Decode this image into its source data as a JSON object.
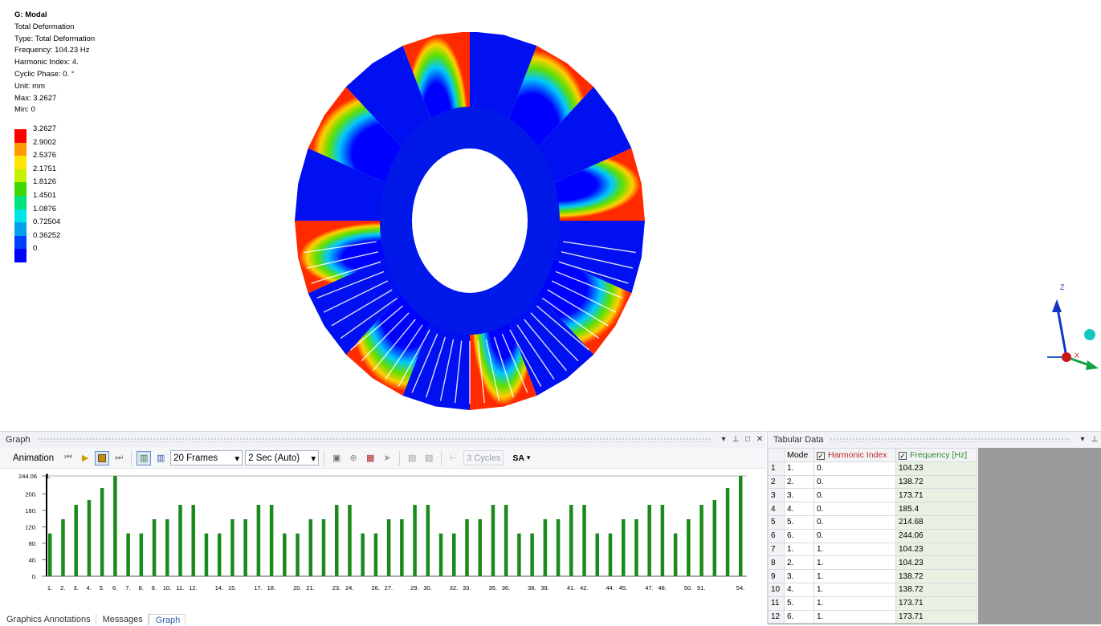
{
  "viewport": {
    "info": {
      "title": "G: Modal",
      "lines": [
        "Total Deformation",
        "Type: Total Deformation",
        "Frequency: 104.23 Hz",
        "Harmonic Index: 4.",
        "Cyclic Phase: 0. °",
        "Unit: mm",
        "Max: 3.2627",
        "Min: 0"
      ]
    },
    "legend": [
      {
        "label": "3.2627",
        "color": "#ff0000"
      },
      {
        "label": "2.9002",
        "color": "#ff9a00"
      },
      {
        "label": "2.5376",
        "color": "#ffe600"
      },
      {
        "label": "2.1751",
        "color": "#c5f000"
      },
      {
        "label": "1.8126",
        "color": "#3ed700"
      },
      {
        "label": "1.4501",
        "color": "#00e27c"
      },
      {
        "label": "1.0876",
        "color": "#00e5e5"
      },
      {
        "label": "0.72504",
        "color": "#00a2f0"
      },
      {
        "label": "0.36252",
        "color": "#0040ff"
      },
      {
        "label": "0",
        "color": "#0000ff"
      }
    ],
    "triad": {
      "z_label": "Z",
      "x_label": "X"
    }
  },
  "graph_panel": {
    "title": "Graph",
    "animation_label": "Animation",
    "frames_value": "20 Frames",
    "duration_value": "2 Sec (Auto)",
    "cycles_value": "3 Cycles",
    "sa_label": "SA",
    "bottom_tabs": [
      "Graphics Annotations",
      "Messages",
      "Graph"
    ]
  },
  "chart_data": {
    "type": "bar",
    "marker_label": "1.",
    "yticks": [
      "244.06",
      "200.",
      "160.",
      "120.",
      "80.",
      "40.",
      "0."
    ],
    "ytick_values": [
      244.06,
      200,
      160,
      120,
      80,
      40,
      0
    ],
    "ylim": [
      0,
      244.06
    ],
    "xtick_labels": [
      "1.",
      "2.",
      "3.",
      "4.",
      "5.",
      "6.",
      "7.",
      "8.",
      "9.",
      "10.",
      "11.",
      "12.",
      "14.",
      "15.",
      "17.",
      "18.",
      "20.",
      "21.",
      "23.",
      "24.",
      "26.",
      "27.",
      "29.",
      "30.",
      "32.",
      "33.",
      "35.",
      "36.",
      "38.",
      "39.",
      "41.",
      "42.",
      "44.",
      "45.",
      "47.",
      "48.",
      "50.",
      "51.",
      "54."
    ],
    "values": [
      104.23,
      138.72,
      173.71,
      185.4,
      214.68,
      244.06,
      104.23,
      104.23,
      138.72,
      138.72,
      173.71,
      173.71,
      104.23,
      104.23,
      138.72,
      138.72,
      173.71,
      173.71,
      104.23,
      104.23,
      138.72,
      138.72,
      173.71,
      173.71,
      104.23,
      104.23,
      138.72,
      138.72,
      173.71,
      173.71,
      104.23,
      104.23,
      138.72,
      138.72,
      173.71,
      173.71,
      104.23,
      104.23,
      138.72,
      138.72,
      173.71,
      173.71,
      104.23,
      104.23,
      138.72,
      138.72,
      173.71,
      173.71,
      104.23,
      138.72,
      173.71,
      185.4,
      214.68,
      244.06
    ],
    "bar_color": "#1a8a1a"
  },
  "tabular": {
    "title": "Tabular Data",
    "headers": {
      "mode": "Mode",
      "harmonic": "Harmonic Index",
      "frequency": "Frequency [Hz]"
    },
    "rows": [
      {
        "n": "1",
        "mode": "1.",
        "harmonic": "0.",
        "freq": "104.23"
      },
      {
        "n": "2",
        "mode": "2.",
        "harmonic": "0.",
        "freq": "138.72"
      },
      {
        "n": "3",
        "mode": "3.",
        "harmonic": "0.",
        "freq": "173.71"
      },
      {
        "n": "4",
        "mode": "4.",
        "harmonic": "0.",
        "freq": "185.4"
      },
      {
        "n": "5",
        "mode": "5.",
        "harmonic": "0.",
        "freq": "214.68"
      },
      {
        "n": "6",
        "mode": "6.",
        "harmonic": "0.",
        "freq": "244.06"
      },
      {
        "n": "7",
        "mode": "1.",
        "harmonic": "1.",
        "freq": "104.23"
      },
      {
        "n": "8",
        "mode": "2.",
        "harmonic": "1.",
        "freq": "104.23"
      },
      {
        "n": "9",
        "mode": "3.",
        "harmonic": "1.",
        "freq": "138.72"
      },
      {
        "n": "10",
        "mode": "4.",
        "harmonic": "1.",
        "freq": "138.72"
      },
      {
        "n": "11",
        "mode": "5.",
        "harmonic": "1.",
        "freq": "173.71"
      },
      {
        "n": "12",
        "mode": "6.",
        "harmonic": "1.",
        "freq": "173.71"
      }
    ]
  }
}
